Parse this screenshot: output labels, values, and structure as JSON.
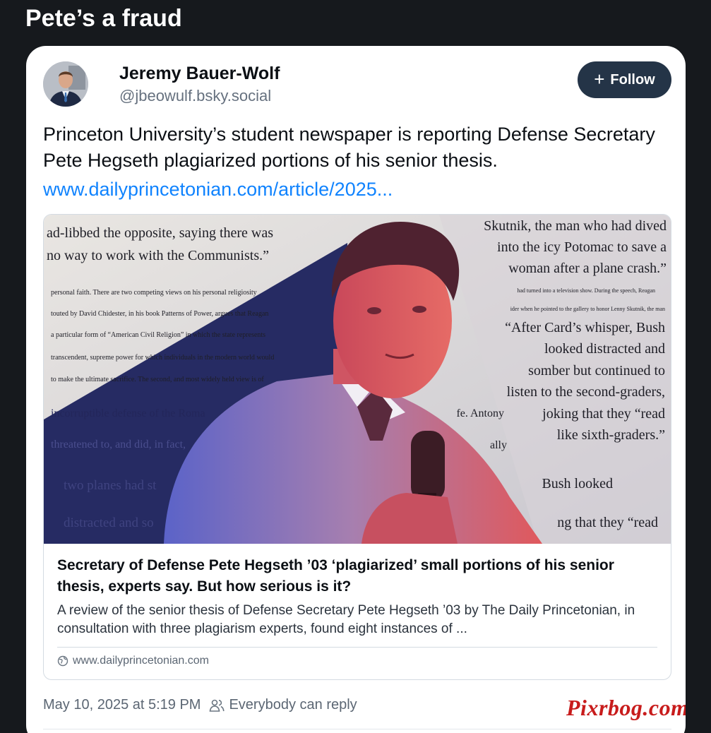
{
  "page": {
    "title": "Pete’s a fraud"
  },
  "post": {
    "author": {
      "name": "Jeremy Bauer-Wolf",
      "handle": "@jbeowulf.bsky.social",
      "avatar_icon": "avatar-photo"
    },
    "follow_label": "Follow",
    "text": "Princeton University’s student newspaper is reporting Defense Secretary Pete Hegseth plagiarized portions of his senior thesis.",
    "link_text": "www.dailyprincetonian.com/article/2025...",
    "link_card": {
      "image_text": {
        "left_top": [
          "ad-libbed the opposite, saying there was",
          "no way to work with the Communists.”"
        ],
        "left_small": [
          "personal faith.  There are two competing views on his personal religiosity",
          "touted by David Chidester, in his book Patterns of Power, argues that Reagan",
          "a particular form of “American Civil Religion” in which the state represents",
          "transcendent, supreme power for which individuals in the modern world would",
          "to make the ultimate sacrifice.  The second, and most widely held view is of"
        ],
        "left_large": [
          "incorruptible defense of the Roma",
          "threatened to, and did, in fact,",
          "two planes had st",
          "distracted and so"
        ],
        "right_top": [
          "Skutnik, the man who had dived",
          "into the icy Potomac to save a",
          "woman after a plane crash.”"
        ],
        "right_small": [
          "had turned into a television show.  During the speech, Reagan",
          "ider when he pointed to the gallery to honor Lenny Skutnik, the man"
        ],
        "right_mid": [
          "“After Card’s whisper, Bush",
          "looked distracted and",
          "somber but continued to",
          "listen to the second-graders,",
          "joking that they “read",
          "like sixth-graders.”"
        ],
        "right_bottom": [
          "Bush looked",
          "ng that they “read"
        ],
        "fragments": [
          "fe. Antony",
          "ally"
        ]
      },
      "title": "Secretary of Defense Pete Hegseth ’03 ‘plagiarized’ small portions of his senior thesis, experts say. But how serious is it?",
      "description": "A review of the senior thesis of Defense Secretary Pete Hegseth ’03 by The Daily Princetonian, in consultation with three plagiarism experts, found eight instances of ...",
      "domain": "www.dailyprincetonian.com",
      "domain_icon": "globe-icon"
    },
    "timestamp": "May 10, 2025 at 5:19 PM",
    "reply_setting": "Everybody can reply",
    "reply_icon": "people-icon"
  },
  "watermark": "Pixrbog.com",
  "colors": {
    "background": "#16191d",
    "card": "#ffffff",
    "follow_button": "#243447",
    "link": "#1083fe",
    "watermark": "#c81c1c"
  }
}
